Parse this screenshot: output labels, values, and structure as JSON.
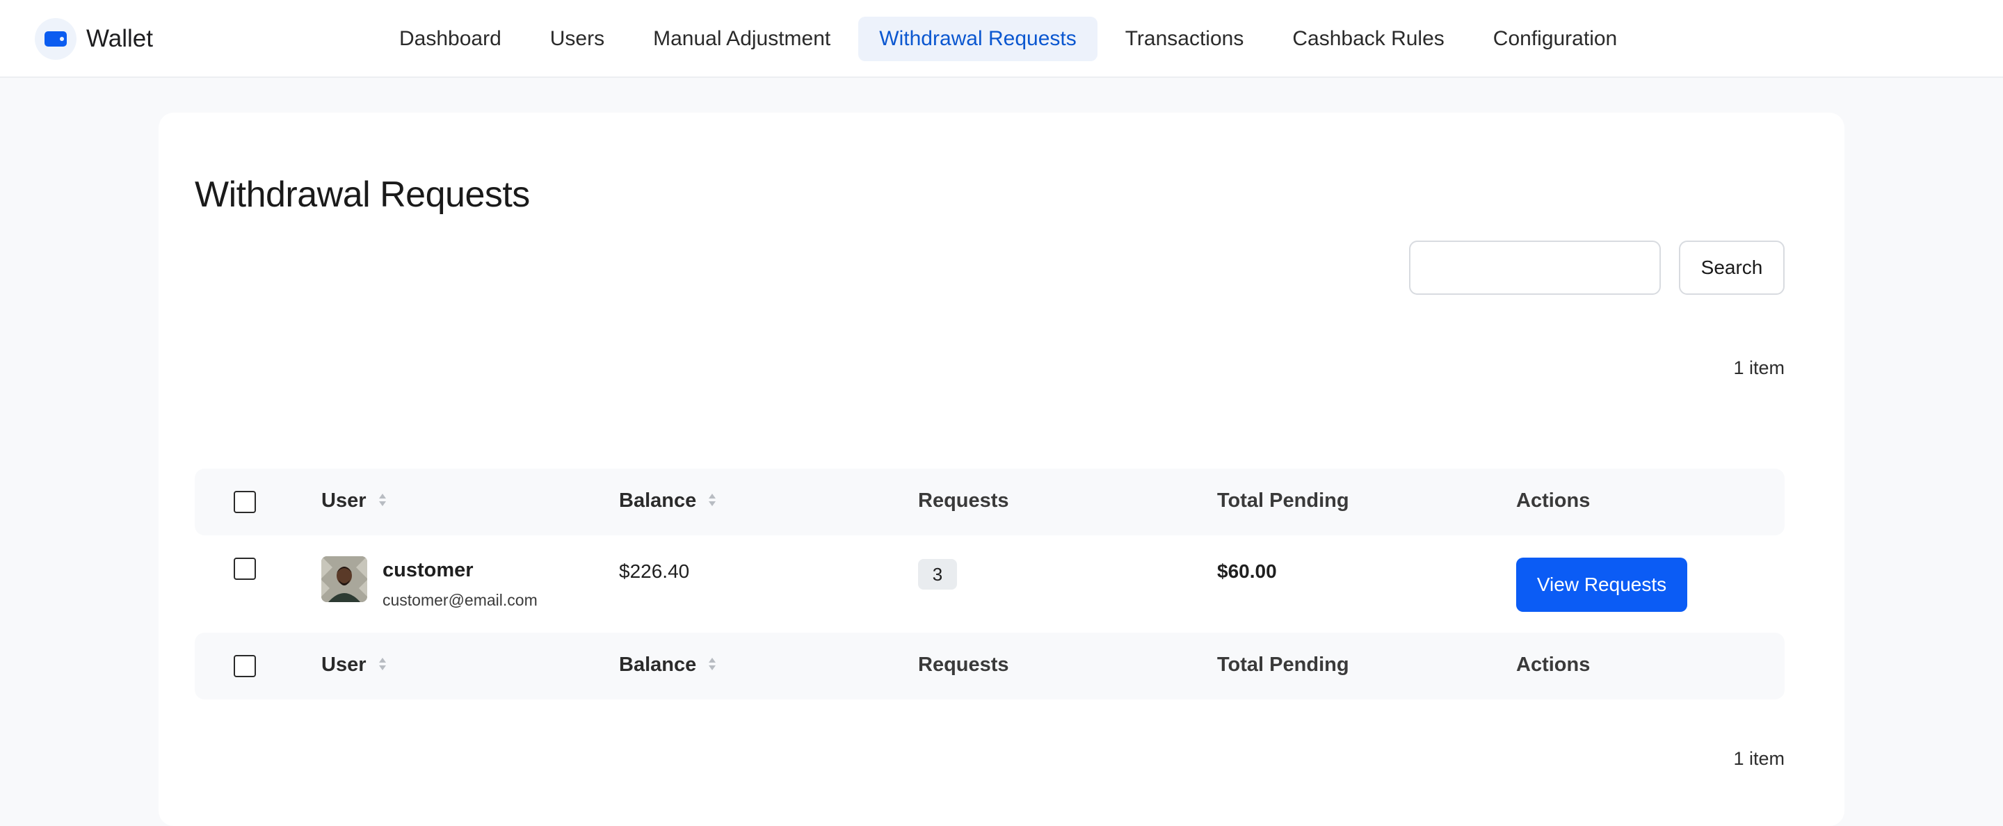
{
  "app": {
    "name": "Wallet"
  },
  "nav": {
    "items": [
      {
        "label": "Dashboard",
        "active": false
      },
      {
        "label": "Users",
        "active": false
      },
      {
        "label": "Manual Adjustment",
        "active": false
      },
      {
        "label": "Withdrawal Requests",
        "active": true
      },
      {
        "label": "Transactions",
        "active": false
      },
      {
        "label": "Cashback Rules",
        "active": false
      },
      {
        "label": "Configuration",
        "active": false
      }
    ]
  },
  "page": {
    "title": "Withdrawal Requests",
    "search": {
      "value": "",
      "placeholder": "",
      "button_label": "Search"
    },
    "item_count_top": "1 item",
    "item_count_bottom": "1 item"
  },
  "table": {
    "columns": {
      "user": "User",
      "balance": "Balance",
      "requests": "Requests",
      "total_pending": "Total Pending",
      "actions": "Actions"
    },
    "rows": [
      {
        "user_name": "customer",
        "user_email": "customer@email.com",
        "balance": "$226.40",
        "requests": "3",
        "total_pending": "$60.00",
        "action_label": "View Requests"
      }
    ]
  },
  "colors": {
    "accent": "#0b5cf5",
    "nav_active_bg": "#edf2fb",
    "nav_active_text": "#0b57d0"
  },
  "icons": [
    "wallet-icon",
    "sort-icon",
    "avatar"
  ]
}
